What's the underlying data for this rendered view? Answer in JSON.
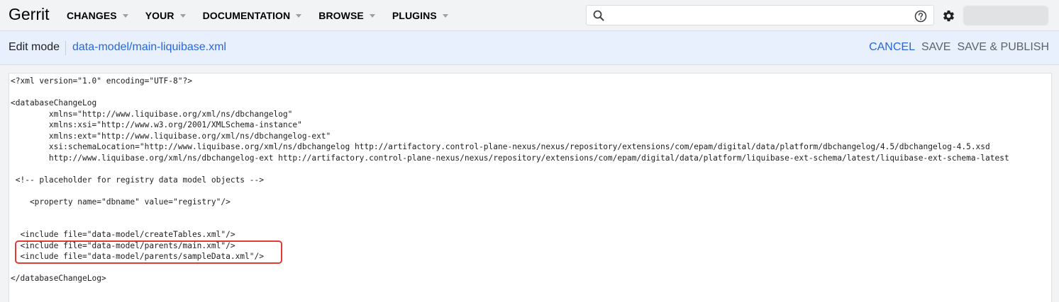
{
  "header": {
    "brand": "Gerrit",
    "nav": [
      {
        "label": "CHANGES"
      },
      {
        "label": "YOUR"
      },
      {
        "label": "DOCUMENTATION"
      },
      {
        "label": "BROWSE"
      },
      {
        "label": "PLUGINS"
      }
    ],
    "search": {
      "value": "",
      "placeholder": ""
    }
  },
  "editbar": {
    "mode_label": "Edit mode",
    "file_path": "data-model/main-liquibase.xml",
    "cancel_label": "CANCEL",
    "save_label": "SAVE",
    "save_publish_label": "SAVE & PUBLISH"
  },
  "editor": {
    "lines": [
      "<?xml version=\"1.0\" encoding=\"UTF-8\"?>",
      "",
      "<databaseChangeLog",
      "        xmlns=\"http://www.liquibase.org/xml/ns/dbchangelog\"",
      "        xmlns:xsi=\"http://www.w3.org/2001/XMLSchema-instance\"",
      "        xmlns:ext=\"http://www.liquibase.org/xml/ns/dbchangelog-ext\"",
      "        xsi:schemaLocation=\"http://www.liquibase.org/xml/ns/dbchangelog http://artifactory.control-plane-nexus/nexus/repository/extensions/com/epam/digital/data/platform/dbchangelog/4.5/dbchangelog-4.5.xsd",
      "        http://www.liquibase.org/xml/ns/dbchangelog-ext http://artifactory.control-plane-nexus/nexus/repository/extensions/com/epam/digital/data/platform/liquibase-ext-schema/latest/liquibase-ext-schema-latest",
      "",
      " <!-- placeholder for registry data model objects -->",
      "",
      "    <property name=\"dbname\" value=\"registry\"/>",
      "",
      "",
      "  <include file=\"data-model/createTables.xml\"/>",
      "  <include file=\"data-model/parents/main.xml\"/>",
      "  <include file=\"data-model/parents/sampleData.xml\"/>",
      "",
      "</databaseChangeLog>"
    ]
  },
  "colors": {
    "accent": "#2a66d9",
    "highlight": "#e53935",
    "editbar_bg": "#e8f0fe"
  }
}
